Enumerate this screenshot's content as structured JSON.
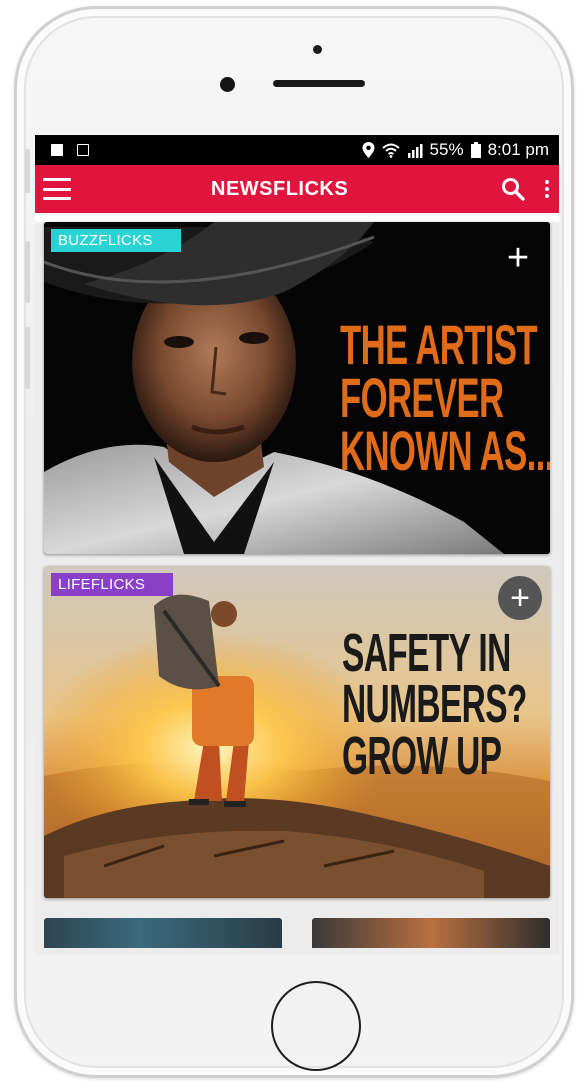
{
  "status_bar": {
    "battery": "55%",
    "time": "8:01 pm"
  },
  "app_bar": {
    "title": "NEWSFLICKS"
  },
  "feed": {
    "cards": [
      {
        "category": "BUZZFLICKS",
        "category_color": "#2ad4d4",
        "headline_lines": [
          "THE ARTIST",
          "FOREVER",
          "KNOWN AS..."
        ],
        "headline_color": "#e06b18",
        "add_label": "+"
      },
      {
        "category": "LIFEFLICKS",
        "category_color": "#8a3fc9",
        "headline_lines": [
          "SAFETY IN",
          "NUMBERS?",
          "GROW UP"
        ],
        "headline_color": "#1a1a1a",
        "add_label": "+"
      }
    ]
  },
  "colors": {
    "accent": "#e0143c",
    "status_bar": "#000000"
  },
  "icons": [
    "menu-icon",
    "search-icon",
    "more-vert-icon",
    "add-icon",
    "location-icon",
    "wifi-icon",
    "signal-icon",
    "battery-icon"
  ]
}
